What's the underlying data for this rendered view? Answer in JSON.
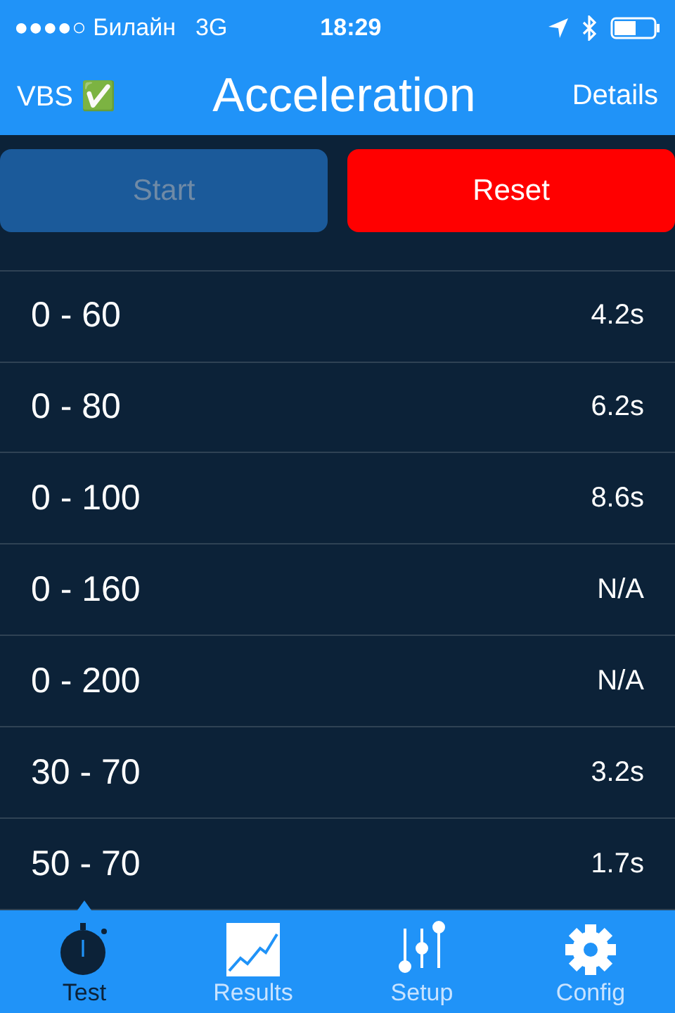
{
  "status_bar": {
    "carrier": "●●●●○ Билайн",
    "network": "3G",
    "time": "18:29"
  },
  "nav": {
    "left": "VBS ✅",
    "title": "Acceleration",
    "right": "Details"
  },
  "buttons": [
    {
      "label": "Start",
      "disabled": true,
      "kind": "start"
    },
    {
      "label": "Reset",
      "disabled": false,
      "kind": "reset"
    }
  ],
  "rows": [
    {
      "range": "0 - 60",
      "time": "4.2s"
    },
    {
      "range": "0 - 80",
      "time": "6.2s"
    },
    {
      "range": "0 - 100",
      "time": "8.6s"
    },
    {
      "range": "0 - 160",
      "time": "N/A"
    },
    {
      "range": "0 - 200",
      "time": "N/A"
    },
    {
      "range": "30 - 70",
      "time": "3.2s"
    },
    {
      "range": "50 - 70",
      "time": "1.7s"
    }
  ],
  "tabs": [
    {
      "label": "Test",
      "kind": "stopwatch",
      "selected": true
    },
    {
      "label": "Results",
      "kind": "chart",
      "selected": false
    },
    {
      "label": "Setup",
      "kind": "sliders",
      "selected": false
    },
    {
      "label": "Config",
      "kind": "gear",
      "selected": false
    }
  ]
}
